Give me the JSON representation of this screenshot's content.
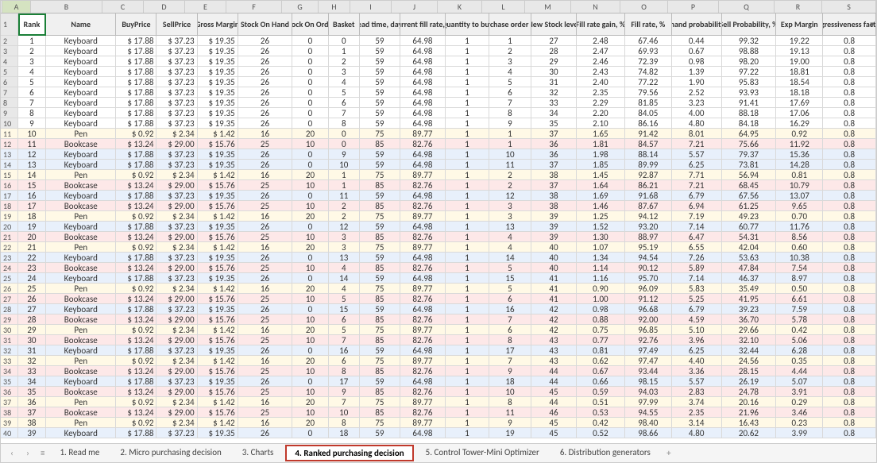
{
  "col_letters": [
    "A",
    "B",
    "C",
    "D",
    "E",
    "F",
    "G",
    "H",
    "I",
    "J",
    "K",
    "L",
    "M",
    "N",
    "O",
    "P",
    "Q",
    "R",
    "S"
  ],
  "headers": [
    "Rank",
    "Name",
    "BuyPrice",
    "SellPrice",
    "Gross Margin",
    "Stock On Hand",
    "Stock On Order",
    "Basket",
    "Lead time, days",
    "Current fill rate, %",
    "Quantity to buy",
    "Purchase order qty",
    "New Stock level",
    "Fill rate gain, %",
    "Fill rate, %",
    "Demand probability, %",
    "Sell Probability, %",
    "Exp Margin",
    "Agressiveness factor"
  ],
  "selected_cell": "A1",
  "rows": [
    {
      "n": 2,
      "rank": 1,
      "name": "Keyboard",
      "buy": "$  17.88",
      "sell": "$  37.23",
      "gm": "$   19.35",
      "soh": 26,
      "soo": 0,
      "basket": 0,
      "lead": 59,
      "cfr": "64.98",
      "qty": 1,
      "poq": 1,
      "ns": 27,
      "frg": "2.48",
      "fr": "67.46",
      "dp": "0.44",
      "sp": "99.32",
      "em": "19.22",
      "agr": "0.8",
      "cls": ""
    },
    {
      "n": 3,
      "rank": 2,
      "name": "Keyboard",
      "buy": "$  17.88",
      "sell": "$  37.23",
      "gm": "$   19.35",
      "soh": 26,
      "soo": 0,
      "basket": 1,
      "lead": 59,
      "cfr": "64.98",
      "qty": 1,
      "poq": 2,
      "ns": 28,
      "frg": "2.47",
      "fr": "69.93",
      "dp": "0.67",
      "sp": "98.88",
      "em": "19.13",
      "agr": "0.8",
      "cls": ""
    },
    {
      "n": 4,
      "rank": 3,
      "name": "Keyboard",
      "buy": "$  17.88",
      "sell": "$  37.23",
      "gm": "$   19.35",
      "soh": 26,
      "soo": 0,
      "basket": 2,
      "lead": 59,
      "cfr": "64.98",
      "qty": 1,
      "poq": 3,
      "ns": 29,
      "frg": "2.46",
      "fr": "72.39",
      "dp": "0.98",
      "sp": "98.20",
      "em": "19.00",
      "agr": "0.8",
      "cls": ""
    },
    {
      "n": 5,
      "rank": 4,
      "name": "Keyboard",
      "buy": "$  17.88",
      "sell": "$  37.23",
      "gm": "$   19.35",
      "soh": 26,
      "soo": 0,
      "basket": 3,
      "lead": 59,
      "cfr": "64.98",
      "qty": 1,
      "poq": 4,
      "ns": 30,
      "frg": "2.43",
      "fr": "74.82",
      "dp": "1.39",
      "sp": "97.22",
      "em": "18.81",
      "agr": "0.8",
      "cls": ""
    },
    {
      "n": 6,
      "rank": 5,
      "name": "Keyboard",
      "buy": "$  17.88",
      "sell": "$  37.23",
      "gm": "$   19.35",
      "soh": 26,
      "soo": 0,
      "basket": 4,
      "lead": 59,
      "cfr": "64.98",
      "qty": 1,
      "poq": 5,
      "ns": 31,
      "frg": "2.40",
      "fr": "77.22",
      "dp": "1.90",
      "sp": "95.83",
      "em": "18.54",
      "agr": "0.8",
      "cls": ""
    },
    {
      "n": 7,
      "rank": 6,
      "name": "Keyboard",
      "buy": "$  17.88",
      "sell": "$  37.23",
      "gm": "$   19.35",
      "soh": 26,
      "soo": 0,
      "basket": 5,
      "lead": 59,
      "cfr": "64.98",
      "qty": 1,
      "poq": 6,
      "ns": 32,
      "frg": "2.35",
      "fr": "79.56",
      "dp": "2.52",
      "sp": "93.93",
      "em": "18.18",
      "agr": "0.8",
      "cls": ""
    },
    {
      "n": 8,
      "rank": 7,
      "name": "Keyboard",
      "buy": "$  17.88",
      "sell": "$  37.23",
      "gm": "$   19.35",
      "soh": 26,
      "soo": 0,
      "basket": 6,
      "lead": 59,
      "cfr": "64.98",
      "qty": 1,
      "poq": 7,
      "ns": 33,
      "frg": "2.29",
      "fr": "81.85",
      "dp": "3.23",
      "sp": "91.41",
      "em": "17.69",
      "agr": "0.8",
      "cls": ""
    },
    {
      "n": 9,
      "rank": 8,
      "name": "Keyboard",
      "buy": "$  17.88",
      "sell": "$  37.23",
      "gm": "$   19.35",
      "soh": 26,
      "soo": 0,
      "basket": 7,
      "lead": 59,
      "cfr": "64.98",
      "qty": 1,
      "poq": 8,
      "ns": 34,
      "frg": "2.20",
      "fr": "84.05",
      "dp": "4.00",
      "sp": "88.18",
      "em": "17.06",
      "agr": "0.8",
      "cls": ""
    },
    {
      "n": 10,
      "rank": 9,
      "name": "Keyboard",
      "buy": "$  17.88",
      "sell": "$  37.23",
      "gm": "$   19.35",
      "soh": 26,
      "soo": 0,
      "basket": 8,
      "lead": 59,
      "cfr": "64.98",
      "qty": 1,
      "poq": 9,
      "ns": 35,
      "frg": "2.10",
      "fr": "86.16",
      "dp": "4.80",
      "sp": "84.18",
      "em": "16.29",
      "agr": "0.8",
      "cls": ""
    },
    {
      "n": 11,
      "rank": 10,
      "name": "Pen",
      "buy": "$    0.92",
      "sell": "$    2.34",
      "gm": "$     1.42",
      "soh": 16,
      "soo": 20,
      "basket": 0,
      "lead": 75,
      "cfr": "89.77",
      "qty": 1,
      "poq": 1,
      "ns": 37,
      "frg": "1.65",
      "fr": "91.42",
      "dp": "8.01",
      "sp": "64.95",
      "em": "0.92",
      "agr": "0.8",
      "cls": "row-yellow"
    },
    {
      "n": 12,
      "rank": 11,
      "name": "Bookcase",
      "buy": "$  13.24",
      "sell": "$  29.00",
      "gm": "$   15.76",
      "soh": 25,
      "soo": 10,
      "basket": 0,
      "lead": 85,
      "cfr": "82.76",
      "qty": 1,
      "poq": 1,
      "ns": 36,
      "frg": "1.81",
      "fr": "84.57",
      "dp": "7.21",
      "sp": "75.66",
      "em": "11.92",
      "agr": "0.8",
      "cls": "row-pink"
    },
    {
      "n": 13,
      "rank": 12,
      "name": "Keyboard",
      "buy": "$  17.88",
      "sell": "$  37.23",
      "gm": "$   19.35",
      "soh": 26,
      "soo": 0,
      "basket": 9,
      "lead": 59,
      "cfr": "64.98",
      "qty": 1,
      "poq": 10,
      "ns": 36,
      "frg": "1.98",
      "fr": "88.14",
      "dp": "5.57",
      "sp": "79.37",
      "em": "15.36",
      "agr": "0.8",
      "cls": "row-blue"
    },
    {
      "n": 14,
      "rank": 13,
      "name": "Keyboard",
      "buy": "$  17.88",
      "sell": "$  37.23",
      "gm": "$   19.35",
      "soh": 26,
      "soo": 0,
      "basket": 10,
      "lead": 59,
      "cfr": "64.98",
      "qty": 1,
      "poq": 11,
      "ns": 37,
      "frg": "1.85",
      "fr": "89.99",
      "dp": "6.25",
      "sp": "73.81",
      "em": "14.28",
      "agr": "0.8",
      "cls": "row-blue"
    },
    {
      "n": 15,
      "rank": 14,
      "name": "Pen",
      "buy": "$    0.92",
      "sell": "$    2.34",
      "gm": "$     1.42",
      "soh": 16,
      "soo": 20,
      "basket": 1,
      "lead": 75,
      "cfr": "89.77",
      "qty": 1,
      "poq": 2,
      "ns": 38,
      "frg": "1.45",
      "fr": "92.87",
      "dp": "7.71",
      "sp": "56.94",
      "em": "0.81",
      "agr": "0.8",
      "cls": "row-yellow"
    },
    {
      "n": 16,
      "rank": 15,
      "name": "Bookcase",
      "buy": "$  13.24",
      "sell": "$  29.00",
      "gm": "$   15.76",
      "soh": 25,
      "soo": 10,
      "basket": 1,
      "lead": 85,
      "cfr": "82.76",
      "qty": 1,
      "poq": 2,
      "ns": 37,
      "frg": "1.64",
      "fr": "86.21",
      "dp": "7.21",
      "sp": "68.45",
      "em": "10.79",
      "agr": "0.8",
      "cls": "row-pink"
    },
    {
      "n": 17,
      "rank": 16,
      "name": "Keyboard",
      "buy": "$  17.88",
      "sell": "$  37.23",
      "gm": "$   19.35",
      "soh": 26,
      "soo": 0,
      "basket": 11,
      "lead": 59,
      "cfr": "64.98",
      "qty": 1,
      "poq": 12,
      "ns": 38,
      "frg": "1.69",
      "fr": "91.68",
      "dp": "6.79",
      "sp": "67.56",
      "em": "13.07",
      "agr": "0.8",
      "cls": "row-blue"
    },
    {
      "n": 18,
      "rank": 17,
      "name": "Bookcase",
      "buy": "$  13.24",
      "sell": "$  29.00",
      "gm": "$   15.76",
      "soh": 25,
      "soo": 10,
      "basket": 2,
      "lead": 85,
      "cfr": "82.76",
      "qty": 1,
      "poq": 3,
      "ns": 38,
      "frg": "1.46",
      "fr": "87.67",
      "dp": "6.94",
      "sp": "61.25",
      "em": "9.65",
      "agr": "0.8",
      "cls": "row-pink"
    },
    {
      "n": 19,
      "rank": 18,
      "name": "Pen",
      "buy": "$    0.92",
      "sell": "$    2.34",
      "gm": "$     1.42",
      "soh": 16,
      "soo": 20,
      "basket": 2,
      "lead": 75,
      "cfr": "89.77",
      "qty": 1,
      "poq": 3,
      "ns": 39,
      "frg": "1.25",
      "fr": "94.12",
      "dp": "7.19",
      "sp": "49.23",
      "em": "0.70",
      "agr": "0.8",
      "cls": "row-yellow"
    },
    {
      "n": 20,
      "rank": 19,
      "name": "Keyboard",
      "buy": "$  17.88",
      "sell": "$  37.23",
      "gm": "$   19.35",
      "soh": 26,
      "soo": 0,
      "basket": 12,
      "lead": 59,
      "cfr": "64.98",
      "qty": 1,
      "poq": 13,
      "ns": 39,
      "frg": "1.52",
      "fr": "93.20",
      "dp": "7.14",
      "sp": "60.77",
      "em": "11.76",
      "agr": "0.8",
      "cls": "row-blue"
    },
    {
      "n": 21,
      "rank": 20,
      "name": "Bookcase",
      "buy": "$  13.24",
      "sell": "$  29.00",
      "gm": "$   15.76",
      "soh": 25,
      "soo": 10,
      "basket": 3,
      "lead": 85,
      "cfr": "82.76",
      "qty": 1,
      "poq": 4,
      "ns": 39,
      "frg": "1.30",
      "fr": "88.97",
      "dp": "6.47",
      "sp": "54.31",
      "em": "8.56",
      "agr": "0.8",
      "cls": "row-pink"
    },
    {
      "n": 22,
      "rank": 21,
      "name": "Pen",
      "buy": "$    0.92",
      "sell": "$    2.34",
      "gm": "$     1.42",
      "soh": 16,
      "soo": 20,
      "basket": 3,
      "lead": 75,
      "cfr": "89.77",
      "qty": 1,
      "poq": 4,
      "ns": 40,
      "frg": "1.07",
      "fr": "95.19",
      "dp": "6.55",
      "sp": "42.04",
      "em": "0.60",
      "agr": "0.8",
      "cls": "row-yellow"
    },
    {
      "n": 23,
      "rank": 22,
      "name": "Keyboard",
      "buy": "$  17.88",
      "sell": "$  37.23",
      "gm": "$   19.35",
      "soh": 26,
      "soo": 0,
      "basket": 13,
      "lead": 59,
      "cfr": "64.98",
      "qty": 1,
      "poq": 14,
      "ns": 40,
      "frg": "1.34",
      "fr": "94.54",
      "dp": "7.26",
      "sp": "53.63",
      "em": "10.38",
      "agr": "0.8",
      "cls": "row-blue"
    },
    {
      "n": 24,
      "rank": 23,
      "name": "Bookcase",
      "buy": "$  13.24",
      "sell": "$  29.00",
      "gm": "$   15.76",
      "soh": 25,
      "soo": 10,
      "basket": 4,
      "lead": 85,
      "cfr": "82.76",
      "qty": 1,
      "poq": 5,
      "ns": 40,
      "frg": "1.14",
      "fr": "90.12",
      "dp": "5.89",
      "sp": "47.84",
      "em": "7.54",
      "agr": "0.8",
      "cls": "row-pink"
    },
    {
      "n": 25,
      "rank": 24,
      "name": "Keyboard",
      "buy": "$  17.88",
      "sell": "$  37.23",
      "gm": "$   19.35",
      "soh": 26,
      "soo": 0,
      "basket": 14,
      "lead": 59,
      "cfr": "64.98",
      "qty": 1,
      "poq": 15,
      "ns": 41,
      "frg": "1.16",
      "fr": "95.70",
      "dp": "7.14",
      "sp": "46.37",
      "em": "8.97",
      "agr": "0.8",
      "cls": "row-blue"
    },
    {
      "n": 26,
      "rank": 25,
      "name": "Pen",
      "buy": "$    0.92",
      "sell": "$    2.34",
      "gm": "$     1.42",
      "soh": 16,
      "soo": 20,
      "basket": 4,
      "lead": 75,
      "cfr": "89.77",
      "qty": 1,
      "poq": 5,
      "ns": 41,
      "frg": "0.90",
      "fr": "96.09",
      "dp": "5.83",
      "sp": "35.49",
      "em": "0.50",
      "agr": "0.8",
      "cls": "row-yellow"
    },
    {
      "n": 27,
      "rank": 26,
      "name": "Bookcase",
      "buy": "$  13.24",
      "sell": "$  29.00",
      "gm": "$   15.76",
      "soh": 25,
      "soo": 10,
      "basket": 5,
      "lead": 85,
      "cfr": "82.76",
      "qty": 1,
      "poq": 6,
      "ns": 41,
      "frg": "1.00",
      "fr": "91.12",
      "dp": "5.25",
      "sp": "41.95",
      "em": "6.61",
      "agr": "0.8",
      "cls": "row-pink"
    },
    {
      "n": 28,
      "rank": 27,
      "name": "Keyboard",
      "buy": "$  17.88",
      "sell": "$  37.23",
      "gm": "$   19.35",
      "soh": 26,
      "soo": 0,
      "basket": 15,
      "lead": 59,
      "cfr": "64.98",
      "qty": 1,
      "poq": 16,
      "ns": 42,
      "frg": "0.98",
      "fr": "96.68",
      "dp": "6.79",
      "sp": "39.23",
      "em": "7.59",
      "agr": "0.8",
      "cls": "row-blue"
    },
    {
      "n": 29,
      "rank": 28,
      "name": "Bookcase",
      "buy": "$  13.24",
      "sell": "$  29.00",
      "gm": "$   15.76",
      "soh": 25,
      "soo": 10,
      "basket": 6,
      "lead": 85,
      "cfr": "82.76",
      "qty": 1,
      "poq": 7,
      "ns": 42,
      "frg": "0.88",
      "fr": "92.00",
      "dp": "4.59",
      "sp": "36.70",
      "em": "5.78",
      "agr": "0.8",
      "cls": "row-pink"
    },
    {
      "n": 30,
      "rank": 29,
      "name": "Pen",
      "buy": "$    0.92",
      "sell": "$    2.34",
      "gm": "$     1.42",
      "soh": 16,
      "soo": 20,
      "basket": 5,
      "lead": 75,
      "cfr": "89.77",
      "qty": 1,
      "poq": 6,
      "ns": 42,
      "frg": "0.75",
      "fr": "96.85",
      "dp": "5.10",
      "sp": "29.66",
      "em": "0.42",
      "agr": "0.8",
      "cls": "row-yellow"
    },
    {
      "n": 31,
      "rank": 30,
      "name": "Bookcase",
      "buy": "$  13.24",
      "sell": "$  29.00",
      "gm": "$   15.76",
      "soh": 25,
      "soo": 10,
      "basket": 7,
      "lead": 85,
      "cfr": "82.76",
      "qty": 1,
      "poq": 8,
      "ns": 43,
      "frg": "0.77",
      "fr": "92.76",
      "dp": "3.96",
      "sp": "32.10",
      "em": "5.06",
      "agr": "0.8",
      "cls": "row-pink"
    },
    {
      "n": 32,
      "rank": 31,
      "name": "Keyboard",
      "buy": "$  17.88",
      "sell": "$  37.23",
      "gm": "$   19.35",
      "soh": 26,
      "soo": 0,
      "basket": 16,
      "lead": 59,
      "cfr": "64.98",
      "qty": 1,
      "poq": 17,
      "ns": 43,
      "frg": "0.81",
      "fr": "97.49",
      "dp": "6.25",
      "sp": "32.44",
      "em": "6.28",
      "agr": "0.8",
      "cls": "row-blue"
    },
    {
      "n": 33,
      "rank": 32,
      "name": "Pen",
      "buy": "$    0.92",
      "sell": "$    2.34",
      "gm": "$     1.42",
      "soh": 16,
      "soo": 20,
      "basket": 6,
      "lead": 75,
      "cfr": "89.77",
      "qty": 1,
      "poq": 7,
      "ns": 43,
      "frg": "0.62",
      "fr": "97.47",
      "dp": "4.40",
      "sp": "24.56",
      "em": "0.35",
      "agr": "0.8",
      "cls": "row-yellow"
    },
    {
      "n": 34,
      "rank": 33,
      "name": "Bookcase",
      "buy": "$  13.24",
      "sell": "$  29.00",
      "gm": "$   15.76",
      "soh": 25,
      "soo": 10,
      "basket": 8,
      "lead": 85,
      "cfr": "82.76",
      "qty": 1,
      "poq": 9,
      "ns": 44,
      "frg": "0.67",
      "fr": "93.44",
      "dp": "3.36",
      "sp": "28.15",
      "em": "4.44",
      "agr": "0.8",
      "cls": "row-pink"
    },
    {
      "n": 35,
      "rank": 34,
      "name": "Keyboard",
      "buy": "$  17.88",
      "sell": "$  37.23",
      "gm": "$   19.35",
      "soh": 26,
      "soo": 0,
      "basket": 17,
      "lead": 59,
      "cfr": "64.98",
      "qty": 1,
      "poq": 18,
      "ns": 44,
      "frg": "0.66",
      "fr": "98.15",
      "dp": "5.57",
      "sp": "26.19",
      "em": "5.07",
      "agr": "0.8",
      "cls": "row-blue"
    },
    {
      "n": 36,
      "rank": 35,
      "name": "Bookcase",
      "buy": "$  13.24",
      "sell": "$  29.00",
      "gm": "$   15.76",
      "soh": 25,
      "soo": 10,
      "basket": 9,
      "lead": 85,
      "cfr": "82.76",
      "qty": 1,
      "poq": 10,
      "ns": 45,
      "frg": "0.59",
      "fr": "94.03",
      "dp": "2.83",
      "sp": "24.78",
      "em": "3.91",
      "agr": "0.8",
      "cls": "row-pink"
    },
    {
      "n": 37,
      "rank": 36,
      "name": "Pen",
      "buy": "$    0.92",
      "sell": "$    2.34",
      "gm": "$     1.42",
      "soh": 16,
      "soo": 20,
      "basket": 7,
      "lead": 75,
      "cfr": "89.77",
      "qty": 1,
      "poq": 8,
      "ns": 44,
      "frg": "0.51",
      "fr": "97.99",
      "dp": "3.74",
      "sp": "20.16",
      "em": "0.29",
      "agr": "0.8",
      "cls": "row-yellow"
    },
    {
      "n": 38,
      "rank": 37,
      "name": "Bookcase",
      "buy": "$  13.24",
      "sell": "$  29.00",
      "gm": "$   15.76",
      "soh": 25,
      "soo": 10,
      "basket": 10,
      "lead": 85,
      "cfr": "82.76",
      "qty": 1,
      "poq": 11,
      "ns": 46,
      "frg": "0.53",
      "fr": "94.55",
      "dp": "2.35",
      "sp": "21.96",
      "em": "3.46",
      "agr": "0.8",
      "cls": "row-pink"
    },
    {
      "n": 39,
      "rank": 38,
      "name": "Pen",
      "buy": "$    0.92",
      "sell": "$    2.34",
      "gm": "$     1.42",
      "soh": 16,
      "soo": 20,
      "basket": 8,
      "lead": 75,
      "cfr": "89.77",
      "qty": 1,
      "poq": 9,
      "ns": 45,
      "frg": "0.42",
      "fr": "98.40",
      "dp": "3.14",
      "sp": "16.43",
      "em": "0.23",
      "agr": "0.8",
      "cls": "row-yellow"
    },
    {
      "n": 40,
      "rank": 39,
      "name": "Keyboard",
      "buy": "$  17.88",
      "sell": "$  37.23",
      "gm": "$   19.35",
      "soh": 26,
      "soo": 0,
      "basket": 18,
      "lead": 59,
      "cfr": "64.98",
      "qty": 1,
      "poq": 19,
      "ns": 45,
      "frg": "0.52",
      "fr": "98.66",
      "dp": "4.80",
      "sp": "20.62",
      "em": "3.99",
      "agr": "0.8",
      "cls": "row-blue"
    }
  ],
  "tabs": [
    {
      "label": "1. Read me",
      "active": false
    },
    {
      "label": "2. Micro purchasing decision",
      "active": false
    },
    {
      "label": "3. Charts",
      "active": false
    },
    {
      "label": "4. Ranked purchasing decision",
      "active": true
    },
    {
      "label": "5. Control Tower-Mini Optimizer",
      "active": false
    },
    {
      "label": "6. Distribution generators",
      "active": false
    }
  ],
  "nav": {
    "prev": "‹",
    "next": "›",
    "menu": "≡",
    "add": "+"
  }
}
